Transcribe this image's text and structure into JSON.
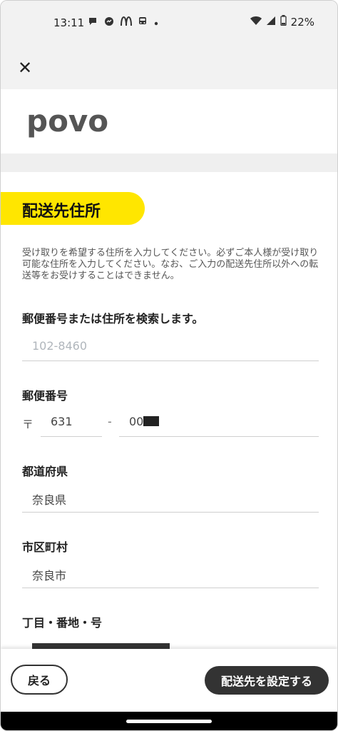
{
  "status": {
    "time": "13:11",
    "battery": "22%",
    "icons": [
      "chat-icon",
      "facebook-messenger-icon",
      "mcdonalds-icon",
      "bus-icon",
      "dot-icon",
      "wifi-icon",
      "signal-icon",
      "battery-icon"
    ]
  },
  "appbar": {
    "close_label": "✕"
  },
  "brand": {
    "logo": "povo"
  },
  "section": {
    "title": "配送先住所",
    "description": "受け取りを希望する住所を入力してください。必ずご本人様が受け取り可能な住所を入力してください。なお、ご入力の配送先住所以外への転送等をお受けすることはできません。"
  },
  "search": {
    "label": "郵便番号または住所を検索します。",
    "placeholder": "102-8460"
  },
  "postal": {
    "label": "郵便番号",
    "symbol": "〒",
    "first": "631",
    "dash": "-",
    "second_prefix": "00"
  },
  "prefecture": {
    "label": "都道府県",
    "value": "奈良県"
  },
  "city": {
    "label": "市区町村",
    "value": "奈良市"
  },
  "street": {
    "label": "丁目・番地・号"
  },
  "footer": {
    "back_label": "戻る",
    "submit_label": "配送先を設定する"
  },
  "colors": {
    "accent": "#ffe600",
    "button_dark": "#333333"
  }
}
